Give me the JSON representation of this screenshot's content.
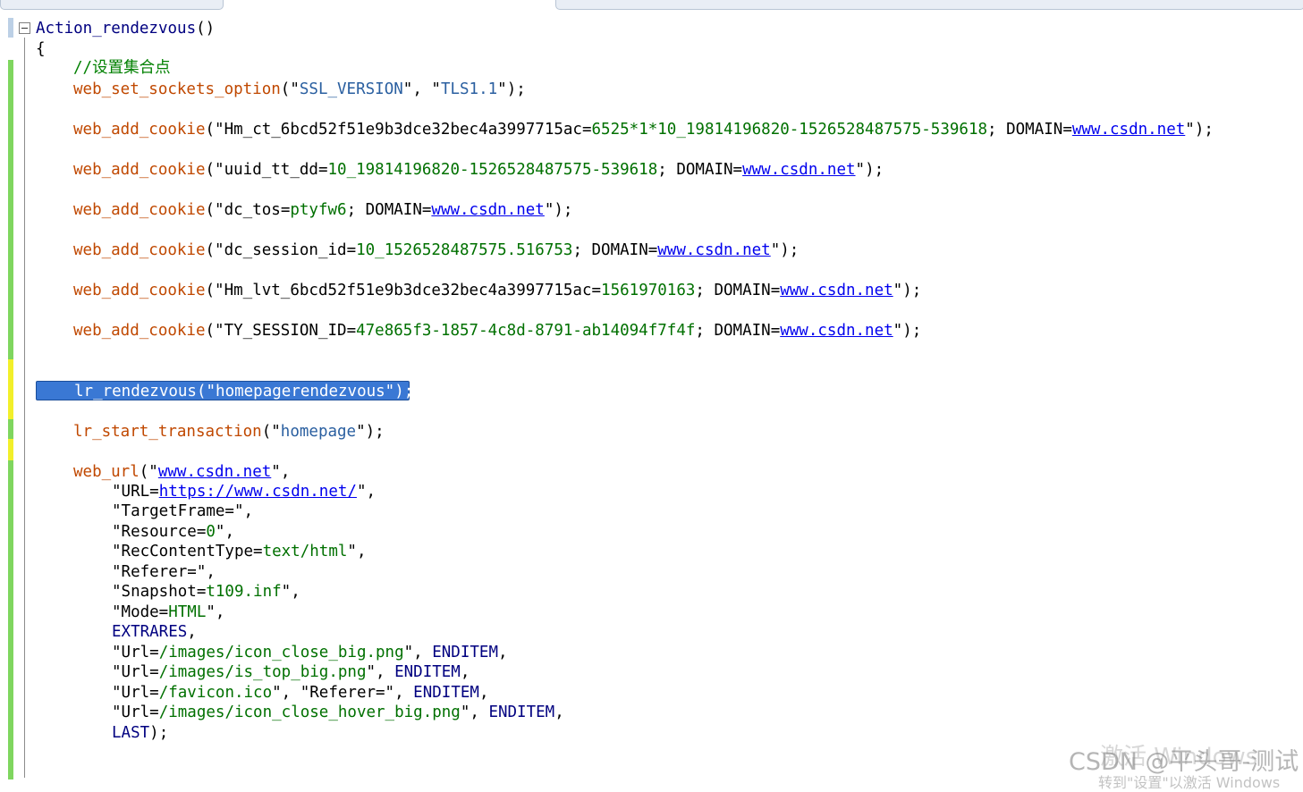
{
  "window": {
    "kind": "code-editor"
  },
  "colors": {
    "keyword": "#000080",
    "function": "#c04800",
    "string": "#2a5fa0",
    "value": "#007000",
    "comment": "#008000",
    "link": "#0000ee",
    "selection": "#3a78d4"
  },
  "code": {
    "l1": {
      "func": "Action_rendezvous",
      "rest": "()"
    },
    "l2": "{",
    "l3": "//设置集合点",
    "l4": {
      "fn": "web_set_sockets_option",
      "a": "(\"",
      "s1": "SSL_VERSION",
      "b": "\", \"",
      "s2": "TLS1.1",
      "c": "\");"
    },
    "c1": {
      "fn": "web_add_cookie",
      "a": "(\"",
      "k": "Hm_ct_6bcd52f51e9b3dce32bec4a3997715ac",
      "eq": "=",
      "v": "6525*1*10_19814196820-1526528487575-539618",
      "d": "; DOMAIN=",
      "link": "www.csdn.net",
      "e": "\");"
    },
    "c2": {
      "fn": "web_add_cookie",
      "a": "(\"",
      "k": "uuid_tt_dd",
      "eq": "=",
      "v": "10_19814196820-1526528487575-539618",
      "d": "; DOMAIN=",
      "link": "www.csdn.net",
      "e": "\");"
    },
    "c3": {
      "fn": "web_add_cookie",
      "a": "(\"",
      "k": "dc_tos",
      "eq": "=",
      "v": "ptyfw6",
      "d": "; DOMAIN=",
      "link": "www.csdn.net",
      "e": "\");"
    },
    "c4": {
      "fn": "web_add_cookie",
      "a": "(\"",
      "k": "dc_session_id",
      "eq": "=",
      "v": "10_1526528487575.516753",
      "d": "; DOMAIN=",
      "link": "www.csdn.net",
      "e": "\");"
    },
    "c5": {
      "fn": "web_add_cookie",
      "a": "(\"",
      "k": "Hm_lvt_6bcd52f51e9b3dce32bec4a3997715ac",
      "eq": "=",
      "v": "1561970163",
      "d": "; DOMAIN=",
      "link": "www.csdn.net",
      "e": "\");"
    },
    "c6": {
      "fn": "web_add_cookie",
      "a": "(\"",
      "k": "TY_SESSION_ID",
      "eq": "=",
      "v": "47e865f3-1857-4c8d-8791-ab14094f7f4f",
      "d": "; DOMAIN=",
      "link": "www.csdn.net",
      "e": "\");"
    },
    "rv": "lr_rendezvous(\"homepagerendezvous\");",
    "st": {
      "fn": "lr_start_transaction",
      "a": "(\"",
      "s": "homepage",
      "e": "\");"
    },
    "wu": {
      "fn": "web_url",
      "a": "(\"",
      "link": "www.csdn.net",
      "e": "\","
    },
    "u1": {
      "a": "\"URL=",
      "link": "https://www.csdn.net/",
      "e": "\","
    },
    "u2": {
      "a": "\"TargetFrame=\","
    },
    "u3": {
      "a": "\"Resource=",
      "v": "0",
      "e": "\","
    },
    "u4": {
      "a": "\"RecContentType=",
      "v": "text/html",
      "e": "\","
    },
    "u5": {
      "a": "\"Referer=\","
    },
    "u6": {
      "a": "\"Snapshot=",
      "v": "t109.inf",
      "e": "\","
    },
    "u7": {
      "a": "\"Mode=",
      "v": "HTML",
      "e": "\","
    },
    "u8": {
      "k": "EXTRARES",
      "e": ","
    },
    "u9": {
      "a": "\"Url=",
      "v": "/images/icon_close_big.png",
      "b": "\", ",
      "k": "ENDITEM",
      "e": ","
    },
    "u10": {
      "a": "\"Url=",
      "v": "/images/is_top_big.png",
      "b": "\", ",
      "k": "ENDITEM",
      "e": ","
    },
    "u11": {
      "a": "\"Url=",
      "v": "/favicon.ico",
      "b": "\", \"Referer=\", ",
      "k": "ENDITEM",
      "e": ","
    },
    "u12": {
      "a": "\"Url=",
      "v": "/images/icon_close_hover_big.png",
      "b": "\", ",
      "k": "ENDITEM",
      "e": ","
    },
    "u13": {
      "k": "LAST",
      "e": ");"
    }
  },
  "watermark": {
    "main": "CSDN @平头哥-测试",
    "overlay": "激活 Windows",
    "sub": "转到\"设置\"以激活 Windows"
  }
}
